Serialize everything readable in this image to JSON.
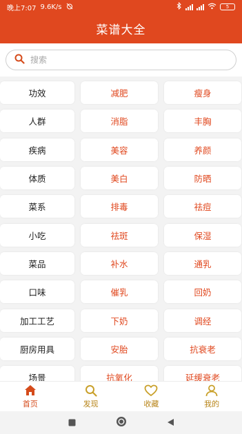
{
  "status_bar": {
    "time": "晚上7:07",
    "net_speed": "9.6K/s",
    "battery": "5"
  },
  "header": {
    "title": "菜谱大全"
  },
  "search": {
    "placeholder": "搜索"
  },
  "grid": {
    "rows": [
      [
        "功效",
        "减肥",
        "瘦身"
      ],
      [
        "人群",
        "消脂",
        "丰胸"
      ],
      [
        "疾病",
        "美容",
        "养颜"
      ],
      [
        "体质",
        "美白",
        "防晒"
      ],
      [
        "菜系",
        "排毒",
        "祛痘"
      ],
      [
        "小吃",
        "祛斑",
        "保湿"
      ],
      [
        "菜品",
        "补水",
        "通乳"
      ],
      [
        "口味",
        "催乳",
        "回奶"
      ],
      [
        "加工工艺",
        "下奶",
        "调经"
      ],
      [
        "厨房用具",
        "安胎",
        "抗衰老"
      ],
      [
        "场景",
        "抗氧化",
        "延缓衰老"
      ]
    ]
  },
  "bottom_nav": {
    "items": [
      {
        "label": "首页",
        "icon": "home-icon"
      },
      {
        "label": "发现",
        "icon": "search-icon"
      },
      {
        "label": "收藏",
        "icon": "heart-icon"
      },
      {
        "label": "我的",
        "icon": "user-icon"
      }
    ]
  },
  "colors": {
    "primary": "#e0481f",
    "nav_active": "#d54b1b",
    "nav_inactive": "#b8851a"
  }
}
